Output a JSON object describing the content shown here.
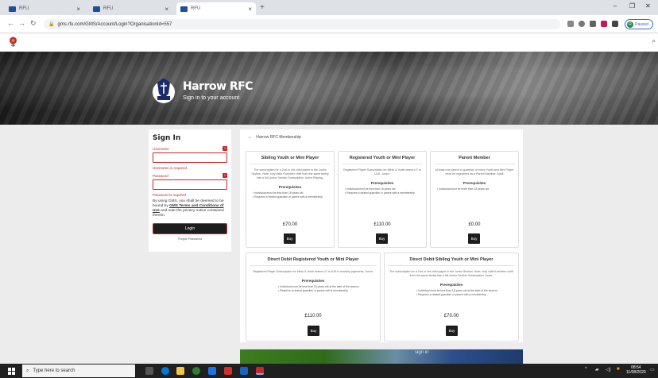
{
  "browser": {
    "tabs": [
      {
        "label": "RFU"
      },
      {
        "label": "RFU"
      },
      {
        "label": "RFU"
      }
    ],
    "new_tab": "+",
    "url": "gms.rfu.com/GMS/Account/Login?OrganisationId=557",
    "profile_label": "Paused",
    "profile_initial": "R"
  },
  "hero": {
    "title": "Harrow RFC",
    "subtitle": "Sign in to your account"
  },
  "signin": {
    "heading": "Sign In",
    "username_label": "Username",
    "username_error": "Username is required",
    "password_label": "Password",
    "password_error": "Password is required",
    "terms_pre": "By using GMS, you shall be deemed to be bound by ",
    "terms_link": "GMS Terms and Conditions of Use",
    "terms_post": " and note the privacy notice contained therein.",
    "login_label": "Login",
    "forgot_label": "Forgot Password"
  },
  "membership": {
    "section_label": "Harrow RFC Membership",
    "cards": [
      {
        "title": "Sibling Youth or Mini Player",
        "desc": "The subscription for a 2nd or 3rd child player in the Junior Section. Note: only valid if another child from the same family has a full Junior Section Subscription Junior Playing.",
        "prereq_title": "Prerequisites",
        "prereqs": [
          "Individual must be less than 18 years old",
          "Requires a related guardian or parent with a membership"
        ],
        "price": "£70.00",
        "buy": "Buy"
      },
      {
        "title": "Registered Youth or Mini Player",
        "desc": "Registered Player Subscription for Minis & Youth teams U7 to U18. Junior.",
        "prereq_title": "Prerequisites",
        "prereqs": [
          "Individual must be less than 18 years old",
          "Requires a related guardian or parent with a membership"
        ],
        "price": "£110.00",
        "buy": "Buy"
      },
      {
        "title": "Parent Member",
        "desc": "At least one parent or guardian of every Youth and Mini Player must be registered as a Parent Member. Adult",
        "prereq_title": "Prerequisites",
        "prereqs": [
          "Individual must be more than 18 years old"
        ],
        "price": "£0.00",
        "buy": "Buy"
      },
      {
        "title": "Direct Debit Registered Youth or Mini Player",
        "desc": "Registered Player Subscription for Minis & Youth teams U7 to U18 in monthly payments. Junior.",
        "prereq_title": "Prerequisites",
        "prereqs": [
          "Individual must be less than 18 years old at the start of the season",
          "Requires a related guardian or parent with a membership"
        ],
        "price": "£110.00",
        "buy": "Buy"
      },
      {
        "title": "Direct Debit Sibling Youth or Mini Player",
        "desc": "The subscription for a 2nd or 3rd child player in the Junior Section. Note: only valid if another child from the same family has a full Junior Section Subscription Junior.",
        "prereq_title": "Prerequisites",
        "prereqs": [
          "Individual must be less than 18 years old at the start of the season",
          "Requires a related guardian or parent with a membership"
        ],
        "price": "£70.00",
        "buy": "Buy"
      }
    ]
  },
  "promo": {
    "text": "sign in"
  },
  "taskbar": {
    "search_placeholder": "Type here to search",
    "time": "08:54",
    "date": "11/08/2020"
  }
}
